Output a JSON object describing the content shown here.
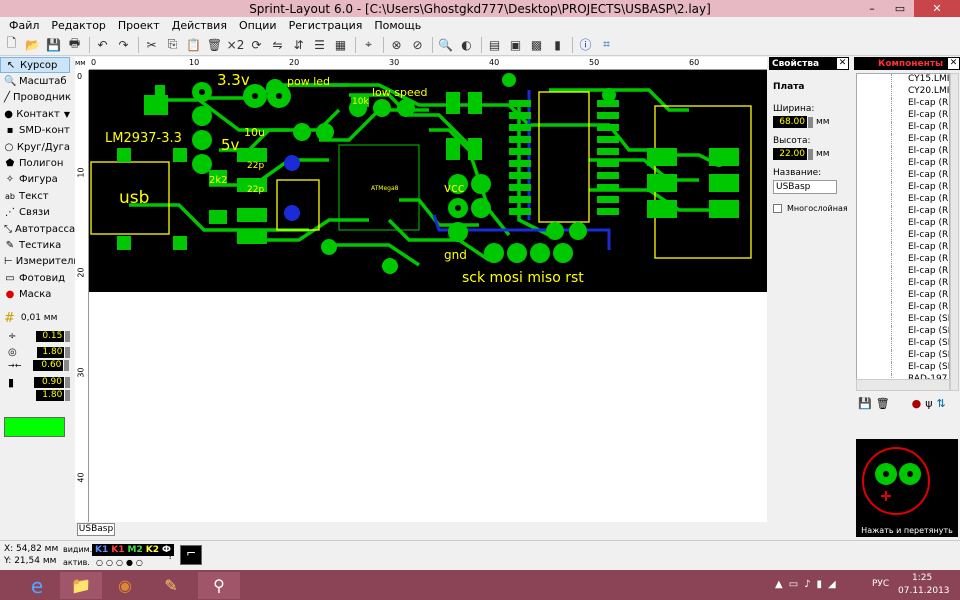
{
  "window": {
    "title": "Sprint-Layout 6.0 - [C:\\Users\\Ghostgkd777\\Desktop\\PROJECTS\\USBASP\\2.lay]"
  },
  "menu": [
    "Файл",
    "Редактор",
    "Проект",
    "Действия",
    "Опции",
    "Регистрация",
    "Помощь"
  ],
  "tools": [
    {
      "label": "Курсор",
      "icon": "cursor-icon"
    },
    {
      "label": "Масштаб",
      "icon": "zoom-icon"
    },
    {
      "label": "Проводник",
      "icon": "track-icon"
    },
    {
      "label": "Контакт",
      "icon": "pad-icon"
    },
    {
      "label": "SMD-конт",
      "icon": "smd-pad-icon"
    },
    {
      "label": "Круг/Дуга",
      "icon": "circle-icon"
    },
    {
      "label": "Полигон",
      "icon": "polygon-icon"
    },
    {
      "label": "Фигура",
      "icon": "shape-icon"
    },
    {
      "label": "Текст",
      "icon": "text-icon"
    },
    {
      "label": "Связи",
      "icon": "connections-icon"
    },
    {
      "label": "Автотрасса",
      "icon": "autoroute-icon"
    },
    {
      "label": "Тестика",
      "icon": "test-icon"
    },
    {
      "label": "Измеритель",
      "icon": "measure-icon"
    },
    {
      "label": "Фотовид",
      "icon": "photoview-icon"
    },
    {
      "label": "Маска",
      "icon": "mask-icon"
    }
  ],
  "grid": {
    "value": "0,01 мм"
  },
  "track_width": "0.15",
  "pad_outer": "1.80",
  "pad_inner": "0.60",
  "smd_w": "0.90",
  "smd_h": "1.80",
  "ruler": {
    "unit": "мм",
    "top": [
      "0",
      "10",
      "20",
      "30",
      "40",
      "50",
      "60"
    ],
    "left": [
      "0",
      "10",
      "20",
      "30",
      "40"
    ]
  },
  "board": {
    "texts": [
      "3.3v",
      "pow led",
      "low speed",
      "LM2937-3.3",
      "usb",
      "5v",
      "10u",
      "2k2",
      "22p",
      "22p",
      "10k",
      "vcc",
      "gnd",
      "sck mosi miso rst",
      "ATMega8"
    ]
  },
  "tab": "USBasp",
  "properties": {
    "header": "Свойства",
    "section": "Плата",
    "width_label": "Ширина:",
    "width": "68.00",
    "height_label": "Высота:",
    "height": "22.00",
    "unit": "мм",
    "name_label": "Название:",
    "name": "USBasp",
    "multilayer": "Многослойная"
  },
  "components": {
    "header": "Компоненты",
    "items": [
      "CY15.LMI",
      "CY20.LMI",
      "El-cap (RM",
      "El-cap (RM",
      "El-cap (RM",
      "El-cap (RM",
      "El-cap (RM",
      "El-cap (RM",
      "El-cap (RM",
      "El-cap (RM",
      "El-cap (RM",
      "El-cap (RM",
      "El-cap (RM",
      "El-cap (RM",
      "El-cap (RM",
      "El-cap (RM",
      "El-cap (RM",
      "El-cap (RM",
      "El-cap (RM",
      "El-cap (RM",
      "El-cap (SM",
      "El-cap (SM",
      "El-cap (SM",
      "El-cap (SM",
      "El-cap (SM",
      "RAD-197."
    ],
    "preview_text": "Нажать и перетянуть"
  },
  "status": {
    "x": "X:  54,82 мм",
    "y": "Y:  21,54 мм",
    "visible": "видим.",
    "active": "актив.",
    "layers": [
      "K1",
      "K1",
      "M2",
      "K2",
      "Ф"
    ],
    "help": "?"
  },
  "taskbar": {
    "lang": "РУС",
    "time": "1:25",
    "date": "07.11.2013"
  },
  "colors": {
    "board": "#000000",
    "copper": "#00cc00",
    "silk": "#ffff00",
    "accent": "#00ff00"
  }
}
